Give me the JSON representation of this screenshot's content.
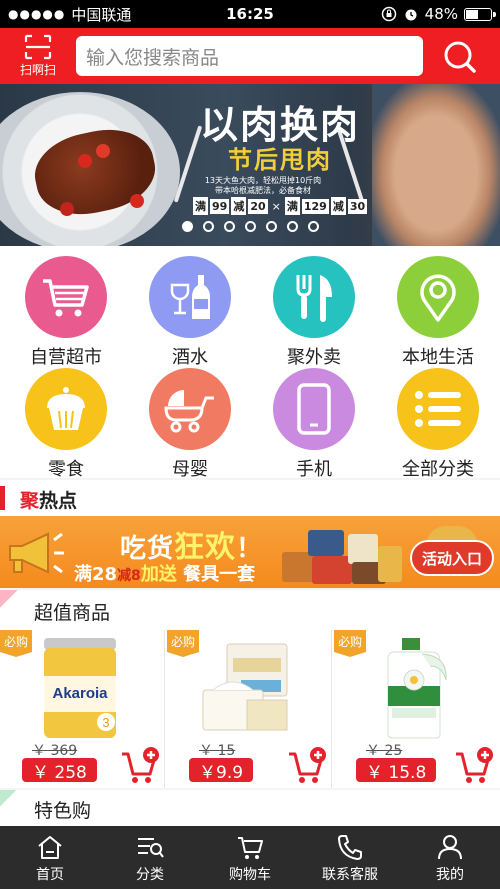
{
  "status_bar": {
    "signal": "●●●●●",
    "carrier": "中国联通",
    "time": "16:25",
    "battery": "48%",
    "battery_level": 0.48
  },
  "header": {
    "scan_label": "扫啊扫",
    "search_placeholder": "输入您搜索商品",
    "icons": [
      "scan-icon",
      "search-icon"
    ],
    "accent_color": "#ef1e22"
  },
  "banner": {
    "title": "以肉换肉",
    "subtitle": "节后甩肉",
    "note_line1": "13天大鱼大肉，轻松甩掉10斤肉",
    "note_line2": "带本哈根减肥法，必备食材",
    "deal1": {
      "prefix": "满",
      "threshold": "99",
      "mid": "减",
      "discount": "20"
    },
    "deal_sep": "×",
    "deal2": {
      "prefix": "满",
      "threshold": "129",
      "mid": "减",
      "discount": "30"
    },
    "slide_count": 7,
    "active_slide": 1
  },
  "categories": [
    {
      "label": "自营超市",
      "icon": "shopping-cart-icon",
      "color": "#e95b8e"
    },
    {
      "label": "酒水",
      "icon": "wine-bottle-icon",
      "color": "#8f9bf2"
    },
    {
      "label": "聚外卖",
      "icon": "fork-knife-icon",
      "color": "#25c2c0"
    },
    {
      "label": "本地生活",
      "icon": "location-pin-icon",
      "color": "#8ccf3a"
    },
    {
      "label": "零食",
      "icon": "cupcake-icon",
      "color": "#f7c21a"
    },
    {
      "label": "母婴",
      "icon": "stroller-icon",
      "color": "#f07a62"
    },
    {
      "label": "手机",
      "icon": "phone-icon",
      "color": "#c98ae0"
    },
    {
      "label": "全部分类",
      "icon": "list-icon",
      "color": "#f7c21a"
    }
  ],
  "hot": {
    "title_red": "聚",
    "title_rest": "热点"
  },
  "activity": {
    "title_prefix": "吃货",
    "title_highlight": "狂欢",
    "title_suffix": "！",
    "line_prefix": "满28",
    "line_red": "减8",
    "line_highlight": "加送",
    "line_suffix": "餐具一套",
    "entry_label": "活动入口"
  },
  "value_section": {
    "title": "超值商品",
    "products": [
      {
        "tag": "必购",
        "name_on_pack": "Akaroia",
        "old_price": "￥ 369",
        "price": "￥ 258"
      },
      {
        "tag": "必购",
        "old_price": "￥ 15",
        "price": "￥9.9"
      },
      {
        "tag": "必购",
        "old_price": "￥ 25",
        "price": "￥ 15.8"
      }
    ]
  },
  "special_section": {
    "title": "特色购"
  },
  "tabbar": {
    "items": [
      {
        "label": "首页",
        "icon": "home-icon"
      },
      {
        "label": "分类",
        "icon": "category-icon"
      },
      {
        "label": "购物车",
        "icon": "cart-icon"
      },
      {
        "label": "联系客服",
        "icon": "phone-call-icon"
      },
      {
        "label": "我的",
        "icon": "user-icon"
      }
    ]
  }
}
